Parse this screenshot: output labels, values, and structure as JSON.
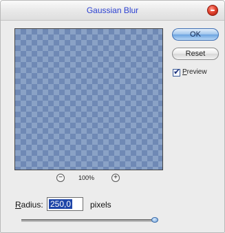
{
  "window": {
    "title": "Gaussian Blur"
  },
  "buttons": {
    "ok_label": "OK",
    "reset_label": "Reset"
  },
  "preview": {
    "checkbox_checked": true,
    "label_mnemonic": "P",
    "label_rest": "review"
  },
  "zoom": {
    "out_symbol": "−",
    "level": "100%",
    "in_symbol": "+"
  },
  "radius": {
    "label_mnemonic": "R",
    "label_rest": "adius:",
    "value": "250,0",
    "unit": "pixels",
    "slider_fraction": 1.0
  },
  "colors": {
    "title_text": "#2a3fd1",
    "selection": "#1f46a8",
    "close_button": "#e2432f"
  },
  "icons": {
    "close": "close-icon",
    "zoom_out": "minus-icon",
    "zoom_in": "plus-icon",
    "checkmark": "checkmark-icon"
  }
}
